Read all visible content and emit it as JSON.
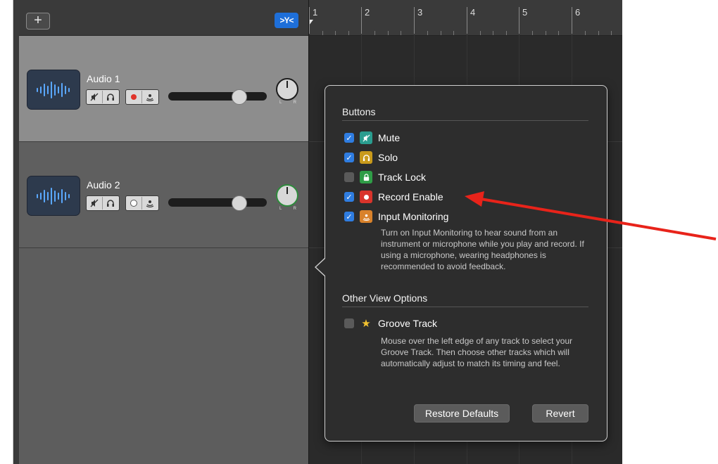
{
  "toolbar": {
    "add_label": "+",
    "filter_label": ">Y<"
  },
  "tracks": [
    {
      "name": "Audio 1",
      "record_enabled": true,
      "volume_level": 0.72
    },
    {
      "name": "Audio 2",
      "record_enabled": false,
      "volume_level": 0.72
    }
  ],
  "knob": {
    "left": "L",
    "right": "R"
  },
  "ruler": {
    "bars": [
      "1",
      "2",
      "3",
      "4",
      "5",
      "6"
    ]
  },
  "popover": {
    "buttons_title": "Buttons",
    "options": [
      {
        "label": "Mute",
        "checked": true,
        "icon": "mute-icon",
        "color": "#2a9d8f"
      },
      {
        "label": "Solo",
        "checked": true,
        "icon": "headphones-icon",
        "color": "#c99a1b"
      },
      {
        "label": "Track Lock",
        "checked": false,
        "icon": "lock-icon",
        "color": "#2f9d47"
      },
      {
        "label": "Record Enable",
        "checked": true,
        "icon": "record-icon",
        "color": "#d9342b"
      },
      {
        "label": "Input Monitoring",
        "checked": true,
        "icon": "input-monitor-icon",
        "color": "#d9822b"
      }
    ],
    "input_monitoring_desc": "Turn on Input Monitoring to hear sound from an instrument or microphone while you play and record. If using a microphone, wearing headphones is recommended to avoid feedback.",
    "other_title": "Other View Options",
    "groove": {
      "label": "Groove Track",
      "checked": false,
      "icon": "star-icon",
      "color": "#f2c230"
    },
    "groove_desc": "Mouse over the left edge of any track to select your Groove Track. Then choose other tracks which will automatically adjust to match its timing and feel.",
    "restore_label": "Restore Defaults",
    "revert_label": "Revert"
  },
  "colors": {
    "accent_blue": "#2f7de1",
    "annotation_red": "#e8231a"
  }
}
